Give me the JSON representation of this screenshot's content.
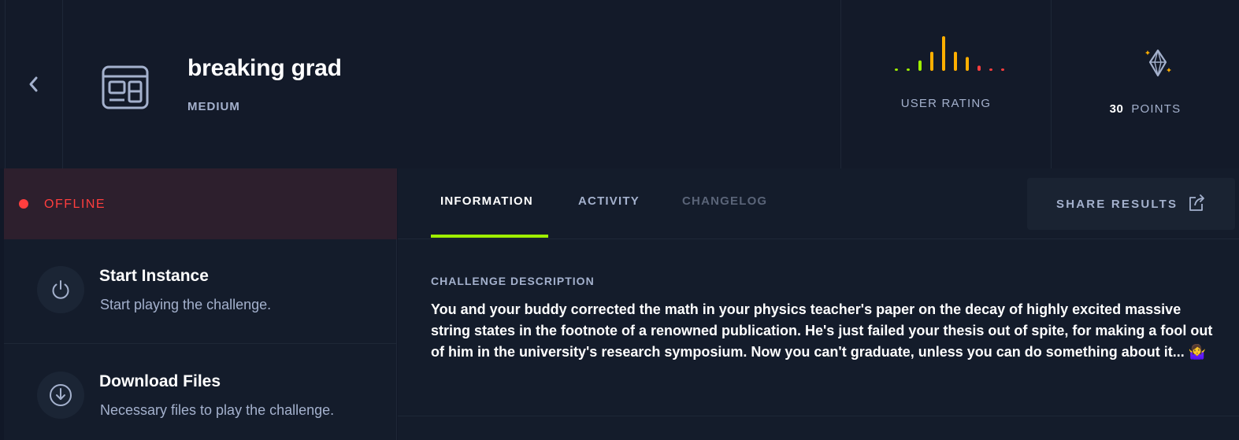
{
  "challenge": {
    "title": "breaking grad",
    "difficulty": "MEDIUM",
    "category_icon": "web-window-icon"
  },
  "rating": {
    "label": "USER RATING",
    "bars": [
      {
        "value": 0.05,
        "color": "#9fef00"
      },
      {
        "value": 0.05,
        "color": "#9fef00"
      },
      {
        "value": 0.3,
        "color": "#9fef00"
      },
      {
        "value": 0.55,
        "color": "#ffaf00"
      },
      {
        "value": 1.0,
        "color": "#ffaf00"
      },
      {
        "value": 0.55,
        "color": "#ffaf00"
      },
      {
        "value": 0.4,
        "color": "#ffaf00"
      },
      {
        "value": 0.15,
        "color": "#ff3e3e"
      },
      {
        "value": 0.05,
        "color": "#ff3e3e"
      },
      {
        "value": 0.05,
        "color": "#ff3e3e"
      }
    ]
  },
  "points": {
    "value": "30",
    "label": "POINTS",
    "icon": "diamond-sparkle-icon"
  },
  "status": {
    "label": "OFFLINE",
    "color": "#ff3e3e"
  },
  "actions": {
    "start": {
      "title": "Start Instance",
      "subtitle": "Start playing the challenge.",
      "icon": "power-icon"
    },
    "download": {
      "title": "Download Files",
      "subtitle": "Necessary files to play the challenge.",
      "icon": "download-icon"
    }
  },
  "tabs": {
    "information": "INFORMATION",
    "activity": "ACTIVITY",
    "changelog": "CHANGELOG",
    "active": "information"
  },
  "share": {
    "label": "SHARE RESULTS",
    "icon": "share-external-icon"
  },
  "description": {
    "heading": "CHALLENGE DESCRIPTION",
    "text": "You and your buddy corrected the math in your physics teacher's paper on the decay of highly excited massive string states in the footnote of a renowned publication. He's just failed your thesis out of spite, for making a fool out of him in the university's research symposium. Now you can't graduate, unless you can do something about it... 🤷‍♀️"
  },
  "colors": {
    "accent": "#9fef00",
    "offline": "#ff3e3e",
    "muted": "#a4b1cd"
  }
}
